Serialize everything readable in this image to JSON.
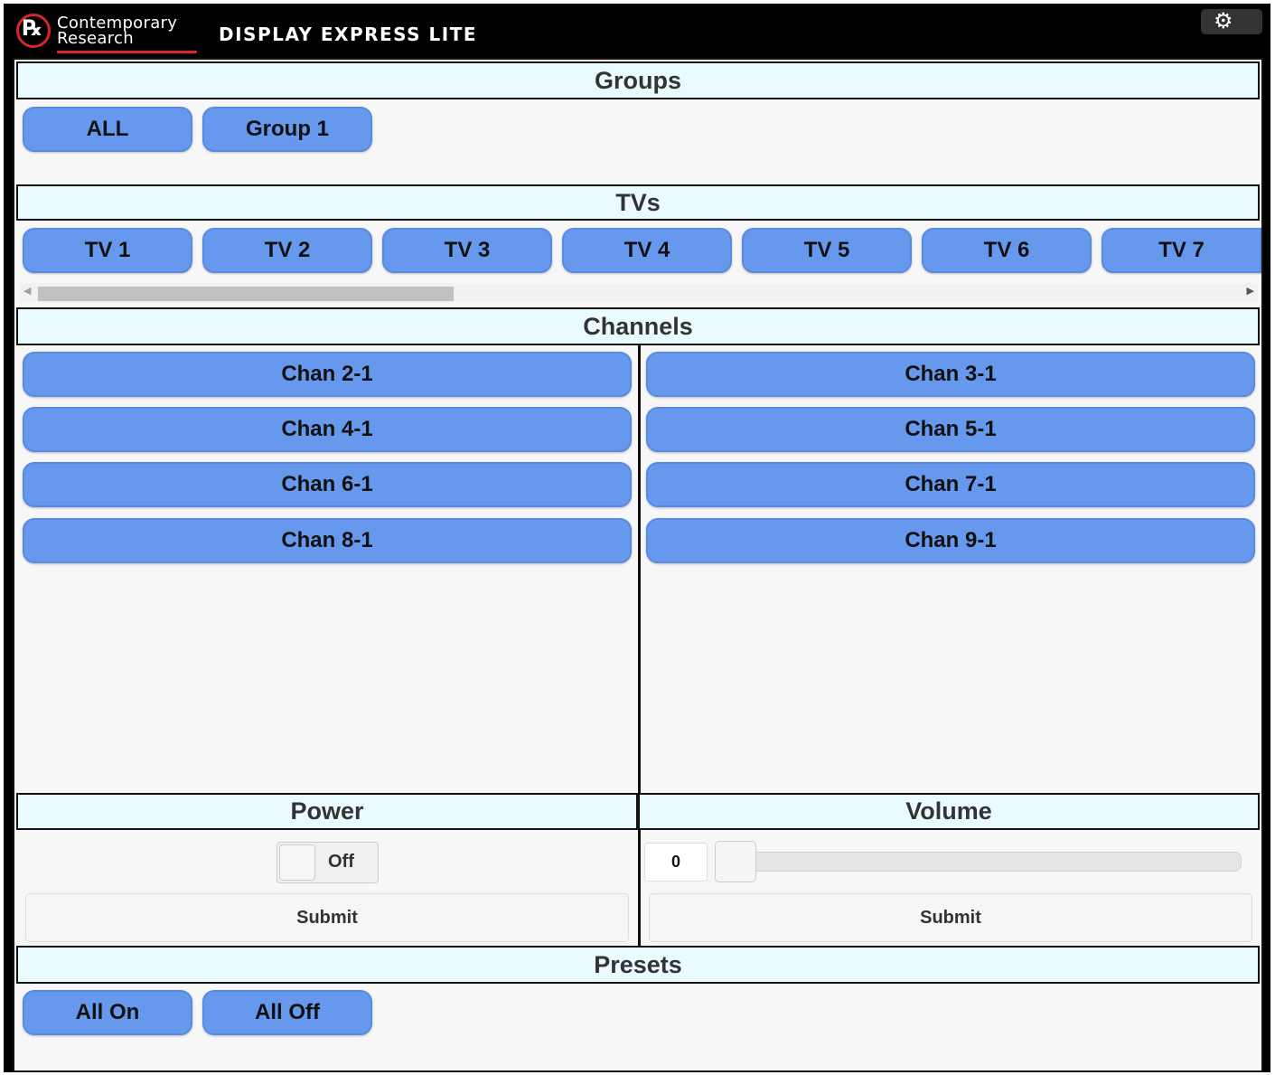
{
  "header": {
    "logo_line1": "Contemporary",
    "logo_line2": "Research",
    "app_title": "DISPLAY EXPRESS LITE",
    "settings_icon": "gear-icon"
  },
  "groups": {
    "title": "Groups",
    "items": [
      "ALL",
      "Group 1"
    ]
  },
  "tvs": {
    "title": "TVs",
    "items": [
      "TV 1",
      "TV 2",
      "TV 3",
      "TV 4",
      "TV 5",
      "TV 6",
      "TV 7"
    ]
  },
  "channels": {
    "title": "Channels",
    "left": [
      "Chan 2-1",
      "Chan 4-1",
      "Chan 6-1",
      "Chan 8-1"
    ],
    "right": [
      "Chan 3-1",
      "Chan 5-1",
      "Chan 7-1",
      "Chan 9-1"
    ]
  },
  "power": {
    "title": "Power",
    "toggle_label": "Off",
    "submit_label": "Submit"
  },
  "volume": {
    "title": "Volume",
    "value": "0",
    "submit_label": "Submit"
  },
  "presets": {
    "title": "Presets",
    "items": [
      "All On",
      "All Off"
    ]
  },
  "colors": {
    "button_blue": "#6699ee",
    "header_bg": "#e9fbff",
    "brand_red": "#d9262c"
  }
}
